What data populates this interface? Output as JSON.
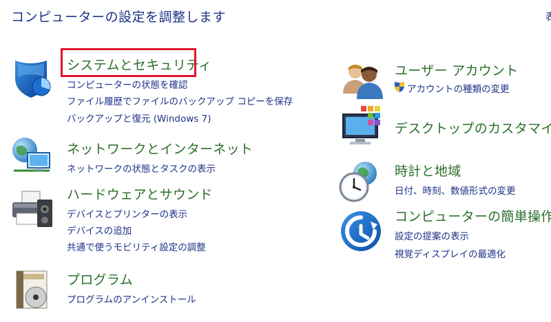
{
  "page": {
    "title": "コンピューターの設定を調整します",
    "view_by_partial": "表"
  },
  "colors": {
    "title": "#1e3287",
    "category_title": "#2a6e2a",
    "link": "#1e3287",
    "highlight": "#e0142a"
  },
  "categories": {
    "system_security": {
      "icon": "shield-icon",
      "title": "システムとセキュリティ",
      "links": [
        "コンピューターの状態を確認",
        "ファイル履歴でファイルのバックアップ コピーを保存",
        "バックアップと復元 (Windows 7)"
      ]
    },
    "network": {
      "icon": "network-globe-icon",
      "title": "ネットワークとインターネット",
      "links": [
        "ネットワークの状態とタスクの表示"
      ]
    },
    "hardware": {
      "icon": "printer-icon",
      "title": "ハードウェアとサウンド",
      "links": [
        "デバイスとプリンターの表示",
        "デバイスの追加",
        "共通で使うモビリティ設定の調整"
      ]
    },
    "programs": {
      "icon": "programs-icon",
      "title": "プログラム",
      "links": [
        "プログラムのアンインストール"
      ]
    },
    "user_accounts": {
      "icon": "users-icon",
      "title": "ユーザー アカウント",
      "links": [
        "アカウントの種類の変更"
      ],
      "link_icon": "uac-shield-icon"
    },
    "appearance": {
      "icon": "monitor-colors-icon",
      "title": "デスクトップのカスタマイズ",
      "links": []
    },
    "clock_region": {
      "icon": "clock-globe-icon",
      "title": "時計と地域",
      "links": [
        "日付、時刻、数値形式の変更"
      ]
    },
    "ease_of_access": {
      "icon": "ease-of-access-icon",
      "title": "コンピューターの簡単操作",
      "links": [
        "設定の提案の表示",
        "視覚ディスプレイの最適化"
      ]
    }
  }
}
